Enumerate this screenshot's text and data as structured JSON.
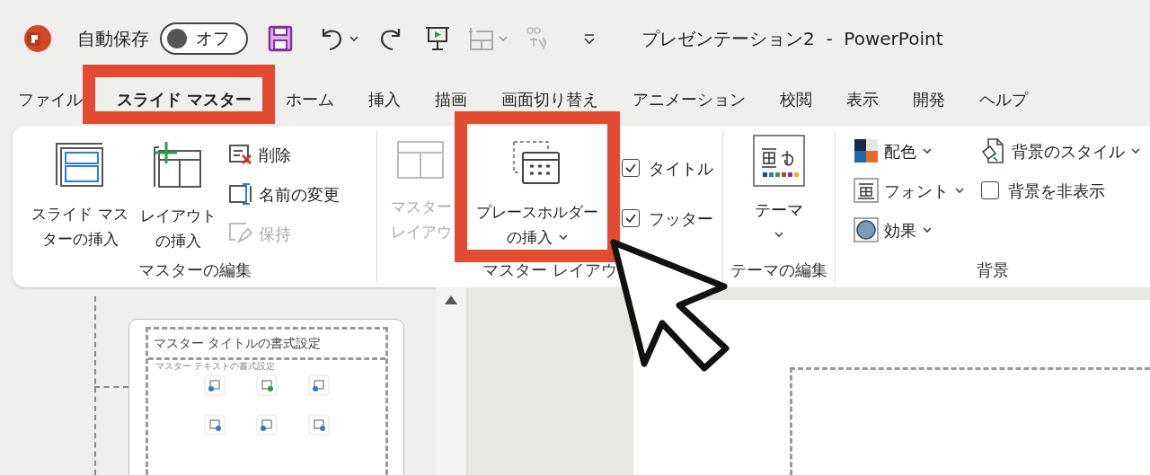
{
  "title_bar": {
    "autosave_label": "自動保存",
    "autosave_toggle": {
      "label": "オフ",
      "on": false
    },
    "title": "プレゼンテーション2  -  PowerPoint"
  },
  "tabs": [
    {
      "label": "ファイル",
      "selected": false
    },
    {
      "label": "スライド マスター",
      "selected": true
    },
    {
      "label": "ホーム",
      "selected": false
    },
    {
      "label": "挿入",
      "selected": false
    },
    {
      "label": "描画",
      "selected": false
    },
    {
      "label": "画面切り替え",
      "selected": false
    },
    {
      "label": "アニメーション",
      "selected": false
    },
    {
      "label": "校閲",
      "selected": false
    },
    {
      "label": "表示",
      "selected": false
    },
    {
      "label": "開発",
      "selected": false
    },
    {
      "label": "ヘルプ",
      "selected": false
    }
  ],
  "ribbon": {
    "edit_master": {
      "label": "マスターの編集",
      "insert_slide_master": [
        "スライド マス",
        "ターの挿入"
      ],
      "insert_layout": [
        "レイアウト",
        "の挿入"
      ],
      "commands": [
        {
          "label": "削除",
          "disabled": false
        },
        {
          "label": "名前の変更",
          "disabled": false
        },
        {
          "label": "保持",
          "disabled": true
        }
      ]
    },
    "master_layout": {
      "label": "マスター レイアウ",
      "master_layout_button": {
        "lines": [
          "マスター",
          "レイアウ"
        ],
        "disabled": true
      },
      "insert_placeholder": [
        "プレースホルダー",
        "の挿入"
      ],
      "checkboxes": [
        {
          "label": "タイトル",
          "checked": true
        },
        {
          "label": "フッター",
          "checked": true
        }
      ]
    },
    "edit_theme": {
      "label": "テーマの編集",
      "themes_button": "テーマ"
    },
    "background": {
      "label": "背景",
      "commands": [
        {
          "label": "配色"
        },
        {
          "label": "フォント"
        },
        {
          "label": "効果"
        },
        {
          "label": "背景のスタイル"
        }
      ],
      "hide_background": {
        "label": "背景を非表示",
        "checked": false
      }
    }
  },
  "thumbnail": {
    "title": "マスター タイトルの書式設定",
    "body": "マスター テキストの書式設定"
  }
}
